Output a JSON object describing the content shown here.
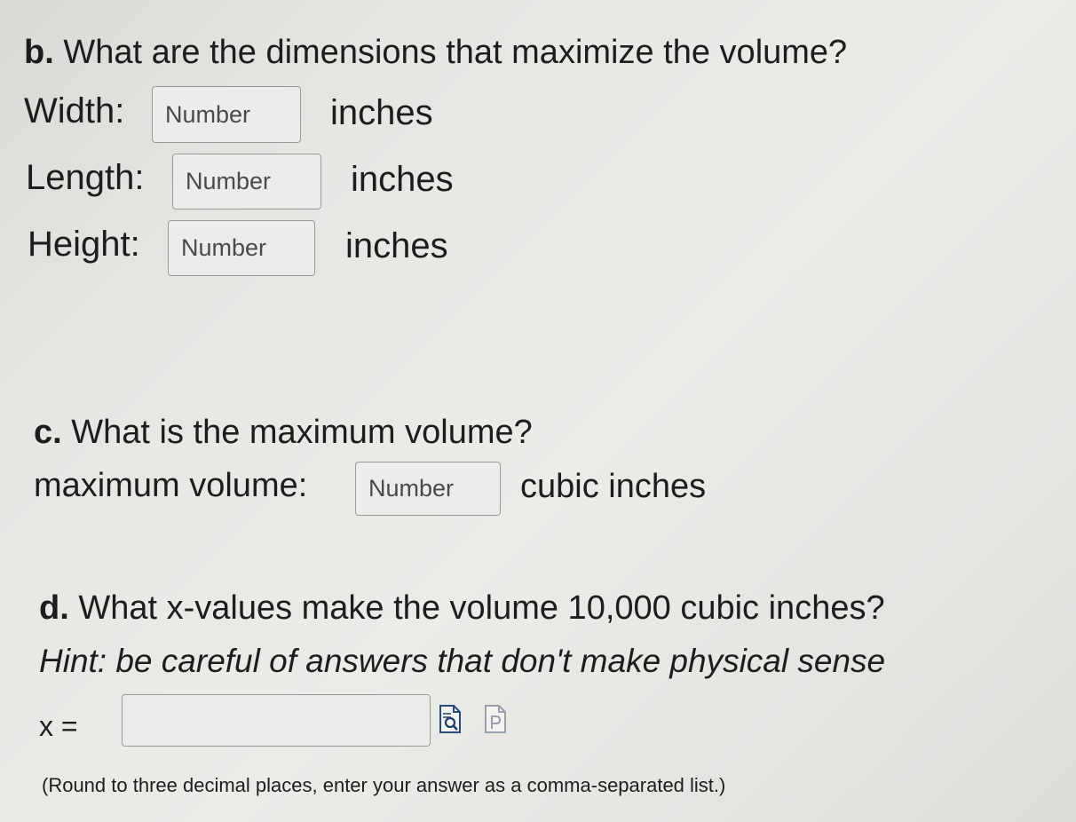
{
  "part_b": {
    "prefix": "b.",
    "question": " What are the dimensions that maximize the volume?",
    "width": {
      "label": "Width:",
      "placeholder": "Number",
      "unit": "inches"
    },
    "length": {
      "label": "Length:",
      "placeholder": "Number",
      "unit": "inches"
    },
    "height": {
      "label": "Height:",
      "placeholder": "Number",
      "unit": "inches"
    }
  },
  "part_c": {
    "prefix": "c.",
    "question": " What is the maximum volume?",
    "label": "maximum volume:",
    "placeholder": "Number",
    "unit": "cubic inches"
  },
  "part_d": {
    "prefix": "d.",
    "question": " What x-values make the volume 10,000 cubic inches?",
    "hint": "Hint: be careful of answers that don't make physical sense",
    "x_label": "x =",
    "x_value": "",
    "note": "(Round to three decimal places, enter your answer as a comma-separated list.)",
    "icons": [
      "preview-icon",
      "formula-help-icon"
    ]
  }
}
